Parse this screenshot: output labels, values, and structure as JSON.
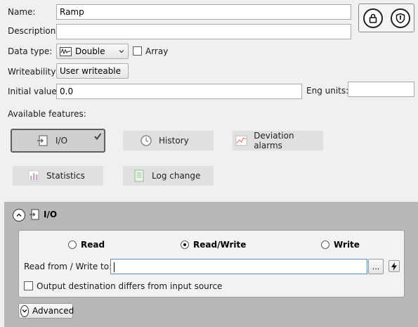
{
  "form": {
    "name_label": "Name:",
    "name_value": "Ramp",
    "description_label": "Description:",
    "description_value": "",
    "data_type_label": "Data type:",
    "data_type_value": "Double",
    "array_label": "Array",
    "writeability_label": "Writeability:",
    "writeability_value": "User writeable",
    "initial_value_label": "Initial value:",
    "initial_value": "0.0",
    "eng_units_label": "Eng units:",
    "eng_units_value": ""
  },
  "features": {
    "title": "Available features:",
    "items": [
      {
        "label": "I/O",
        "selected": true
      },
      {
        "label": "History",
        "selected": false
      },
      {
        "label": "Deviation alarms",
        "selected": false
      },
      {
        "label": "Statistics",
        "selected": false
      },
      {
        "label": "Log change",
        "selected": false
      }
    ]
  },
  "io_panel": {
    "title": "I/O",
    "radio_read": "Read",
    "radio_readwrite": "Read/Write",
    "radio_write": "Write",
    "selected_mode": "Read/Write",
    "read_write_label": "Read from / Write to:",
    "read_write_value": "",
    "browse_label": "...",
    "output_diff_label": "Output destination differs from input source",
    "advanced_label": "Advanced"
  }
}
